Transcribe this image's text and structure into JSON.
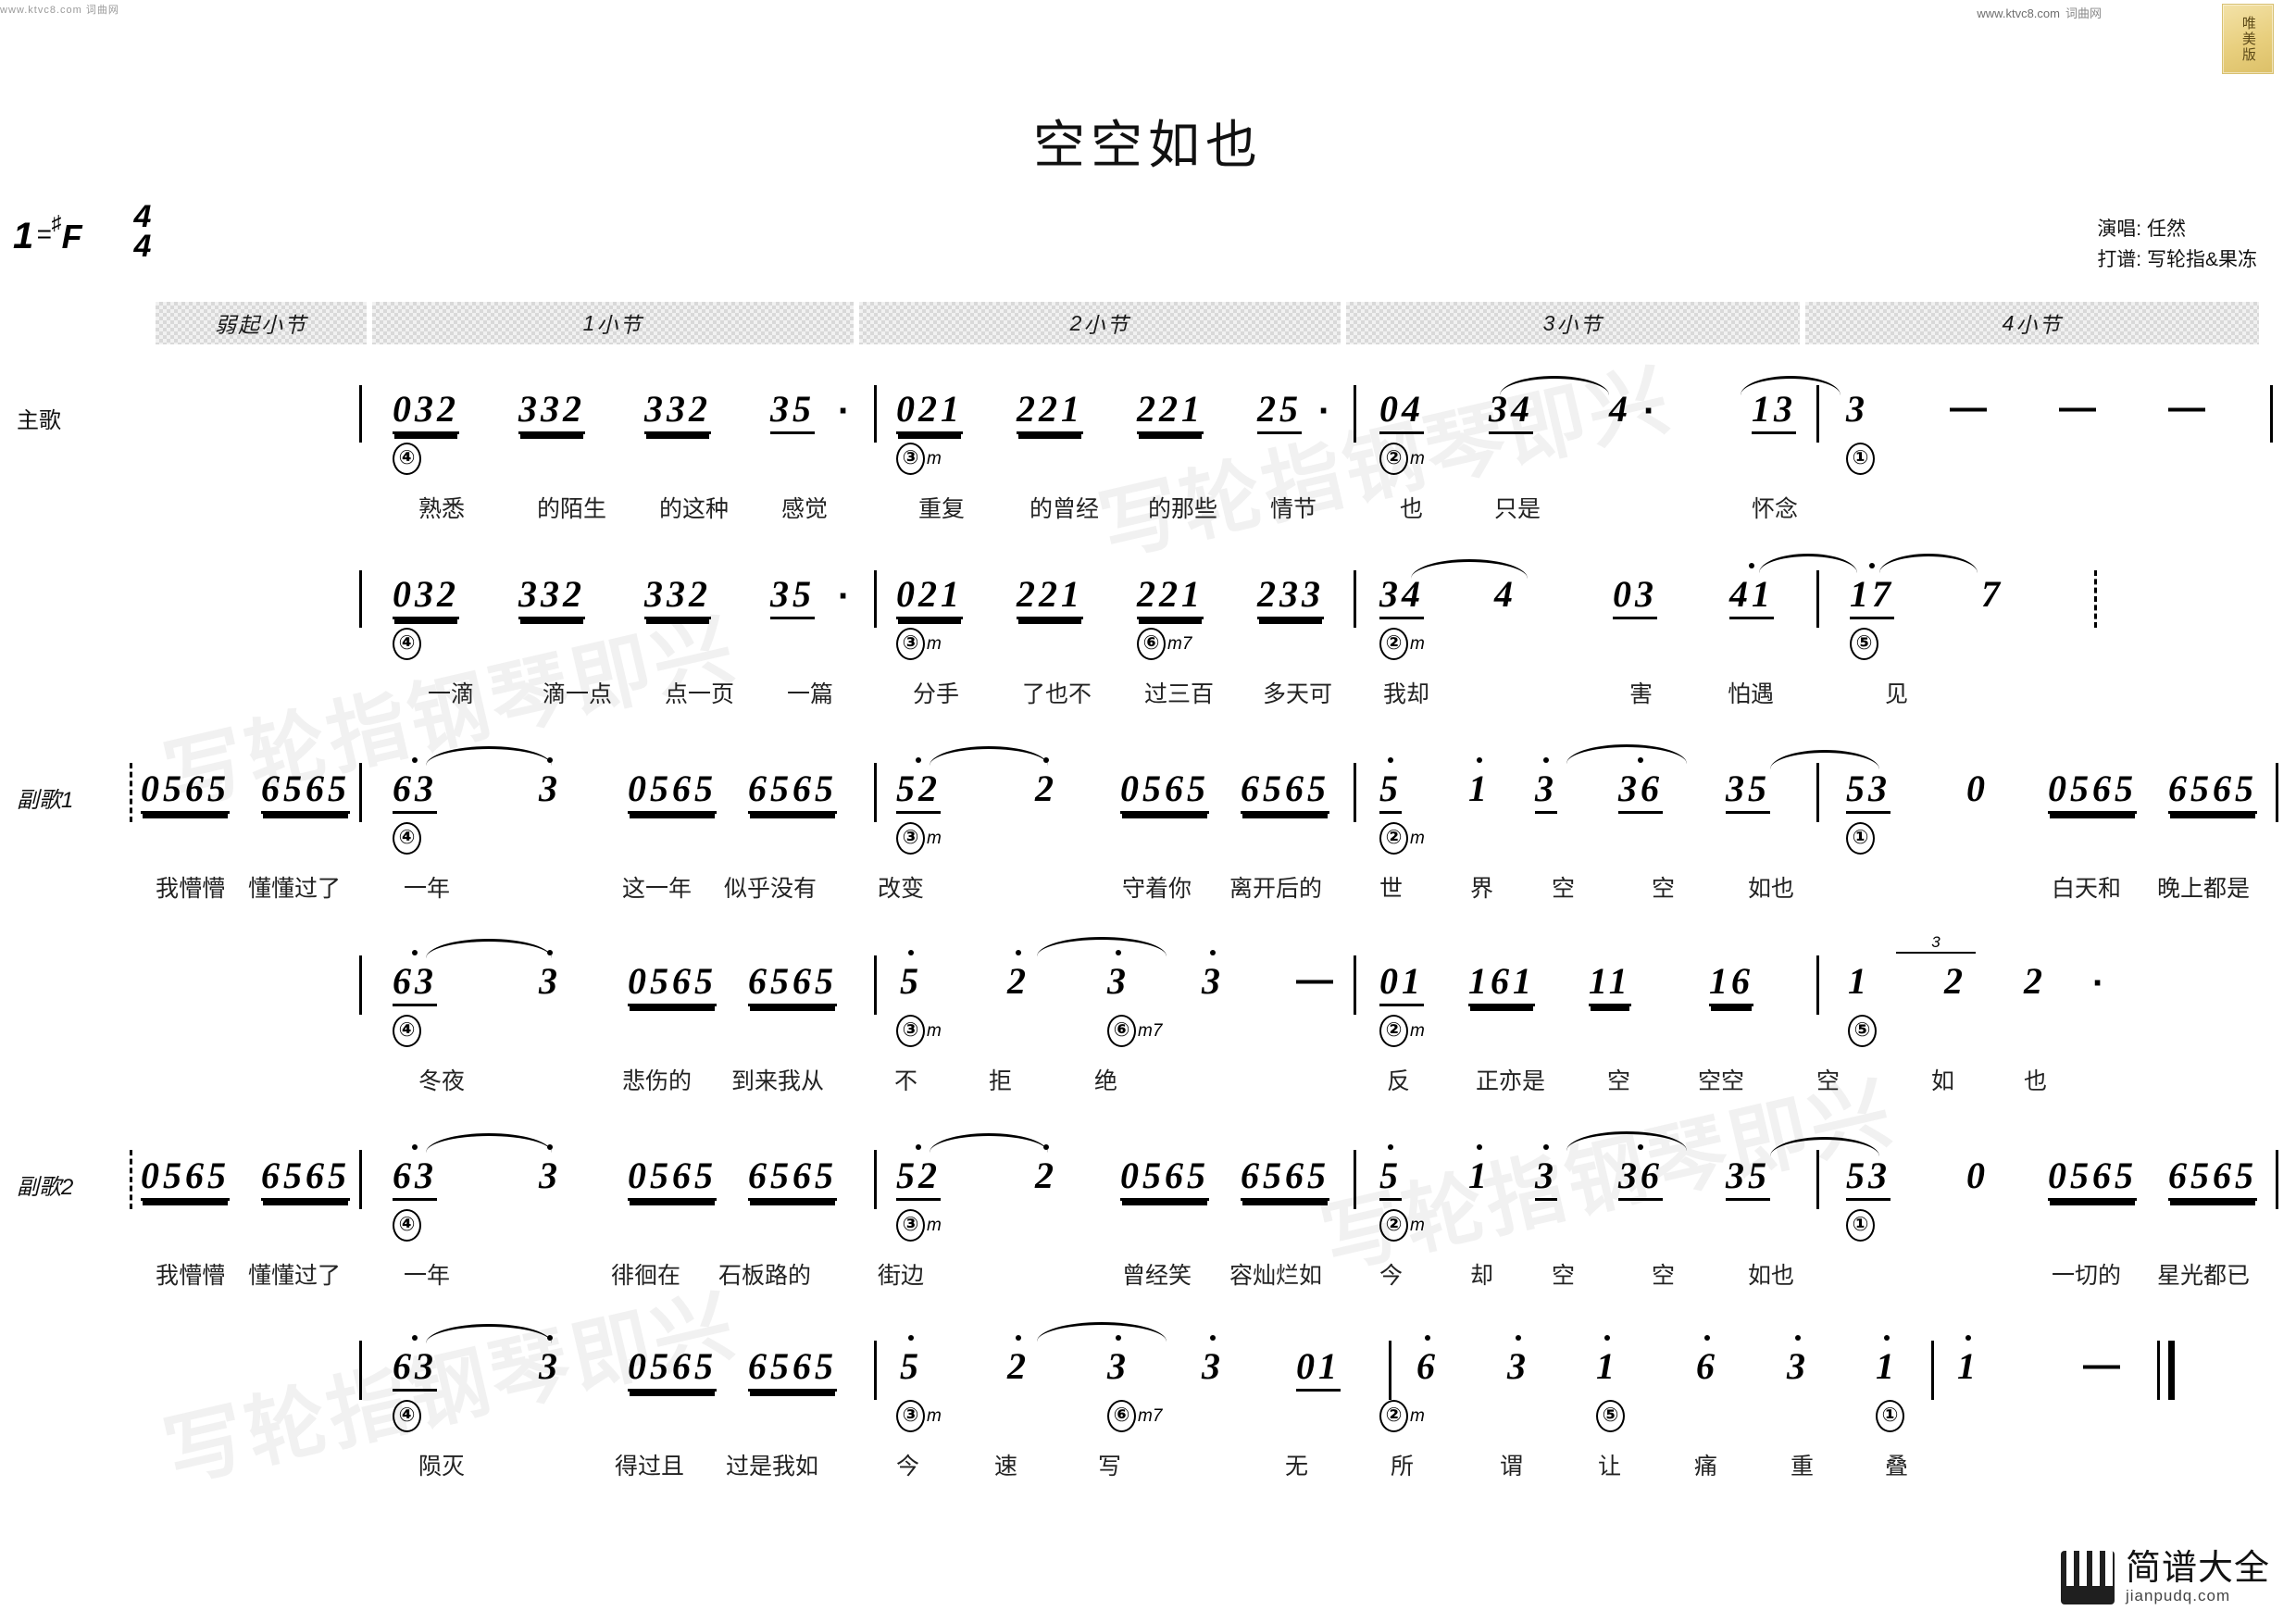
{
  "topbar": {
    "left_text": "www.ktvc8.com  词曲网",
    "right_text": "www.ktvc8.com",
    "right_cn": "词曲网",
    "stamp_text": "唯美版"
  },
  "title": "空空如也",
  "key": {
    "one": "1",
    "equals": "=",
    "sharp": "♯",
    "note": "F"
  },
  "meter": {
    "top": "4",
    "bottom": "4"
  },
  "credits": {
    "singer": "演唱: 任然",
    "transcriber": "打谱: 写轮指&果冻"
  },
  "measure_headers": [
    {
      "label": "弱起小节"
    },
    {
      "num": "1",
      "label": " 小节"
    },
    {
      "num": "2",
      "label": " 小节"
    },
    {
      "num": "3",
      "label": " 小节"
    },
    {
      "num": "4",
      "label": " 小节"
    }
  ],
  "rows": [
    {
      "label": "主歌",
      "notes": [
        "032",
        "332",
        "332",
        "35",
        "·",
        "021",
        "221",
        "221",
        "25",
        "·",
        "04",
        "34",
        "4",
        "·",
        "13",
        "3",
        "—",
        "—",
        "—"
      ],
      "chords": [
        "④",
        "③m",
        "②m",
        "①"
      ],
      "lyrics": [
        "熟悉",
        "的陌生",
        "的这种",
        "感觉",
        "重复",
        "的曾经",
        "的那些",
        "情节",
        "也",
        "只是",
        "怀念"
      ]
    },
    {
      "label": "",
      "notes": [
        "032",
        "332",
        "332",
        "35",
        "·",
        "021",
        "221",
        "221",
        "233",
        "34",
        "4",
        "03",
        "41",
        "17",
        "7"
      ],
      "chords": [
        "④",
        "③m",
        "⑥m7",
        "②m",
        "⑤"
      ],
      "lyrics": [
        "一滴",
        "滴一点",
        "点一页",
        "一篇",
        "分手",
        "了也不",
        "过三百",
        "多天可",
        "我却",
        "害",
        "怕遇",
        "见"
      ]
    },
    {
      "label": "副歌1",
      "notes": [
        "0565",
        "6565",
        "63",
        "3",
        "0565",
        "6565",
        "52",
        "2",
        "0565",
        "6565",
        "5",
        "1",
        "3",
        "36",
        "35",
        "53",
        "0",
        "0565",
        "6565"
      ],
      "chords": [
        "④",
        "③m",
        "②m",
        "①"
      ],
      "lyrics": [
        "我懵懵",
        "懂懂过了",
        "一年",
        "这一年",
        "似乎没有",
        "改变",
        "守着你",
        "离开后的",
        "世",
        "界",
        "空",
        "空",
        "如也",
        "白天和",
        "晚上都是"
      ]
    },
    {
      "label": "",
      "notes": [
        "63",
        "3",
        "0565",
        "6565",
        "5",
        "2",
        "3",
        "3",
        "—",
        "01",
        "161",
        "11",
        "16",
        "1",
        "2",
        "2"
      ],
      "chords": [
        "④",
        "③m",
        "⑥m7",
        "②m",
        "⑤"
      ],
      "triplet": "3",
      "lyrics": [
        "冬夜",
        "悲伤的",
        "到来我从",
        "不",
        "拒",
        "绝",
        "反",
        "正亦是",
        "空",
        "空空",
        "空",
        "如",
        "也"
      ]
    },
    {
      "label": "副歌2",
      "notes": [
        "0565",
        "6565",
        "63",
        "3",
        "0565",
        "6565",
        "52",
        "2",
        "0565",
        "6565",
        "5",
        "1",
        "3",
        "36",
        "35",
        "53",
        "0",
        "0565",
        "6565"
      ],
      "chords": [
        "④",
        "③m",
        "②m",
        "①"
      ],
      "lyrics": [
        "我懵懵",
        "懂懂过了",
        "一年",
        "徘徊在",
        "石板路的",
        "街边",
        "曾经笑",
        "容灿烂如",
        "今",
        "却",
        "空",
        "空",
        "如也",
        "一切的",
        "星光都已"
      ]
    },
    {
      "label": "",
      "notes": [
        "63",
        "3",
        "0565",
        "6565",
        "5",
        "2",
        "3",
        "3",
        "01",
        "6",
        "3",
        "1",
        "6",
        "3",
        "1",
        "1",
        "—"
      ],
      "chords": [
        "④",
        "③m",
        "⑥m7",
        "②m",
        "⑤",
        "①"
      ],
      "lyrics": [
        "陨灭",
        "得过且",
        "过是我如",
        "今",
        "速",
        "写",
        "无",
        "所",
        "谓",
        "让",
        "痛",
        "重",
        "叠"
      ]
    }
  ],
  "watermarks": [
    "写轮指钢琴即兴",
    "写轮指钢琴即兴",
    "写轮指钢琴即兴",
    "写轮指钢琴即兴"
  ],
  "logo": {
    "title": "简谱大全",
    "sub": "jianpudq.com"
  }
}
